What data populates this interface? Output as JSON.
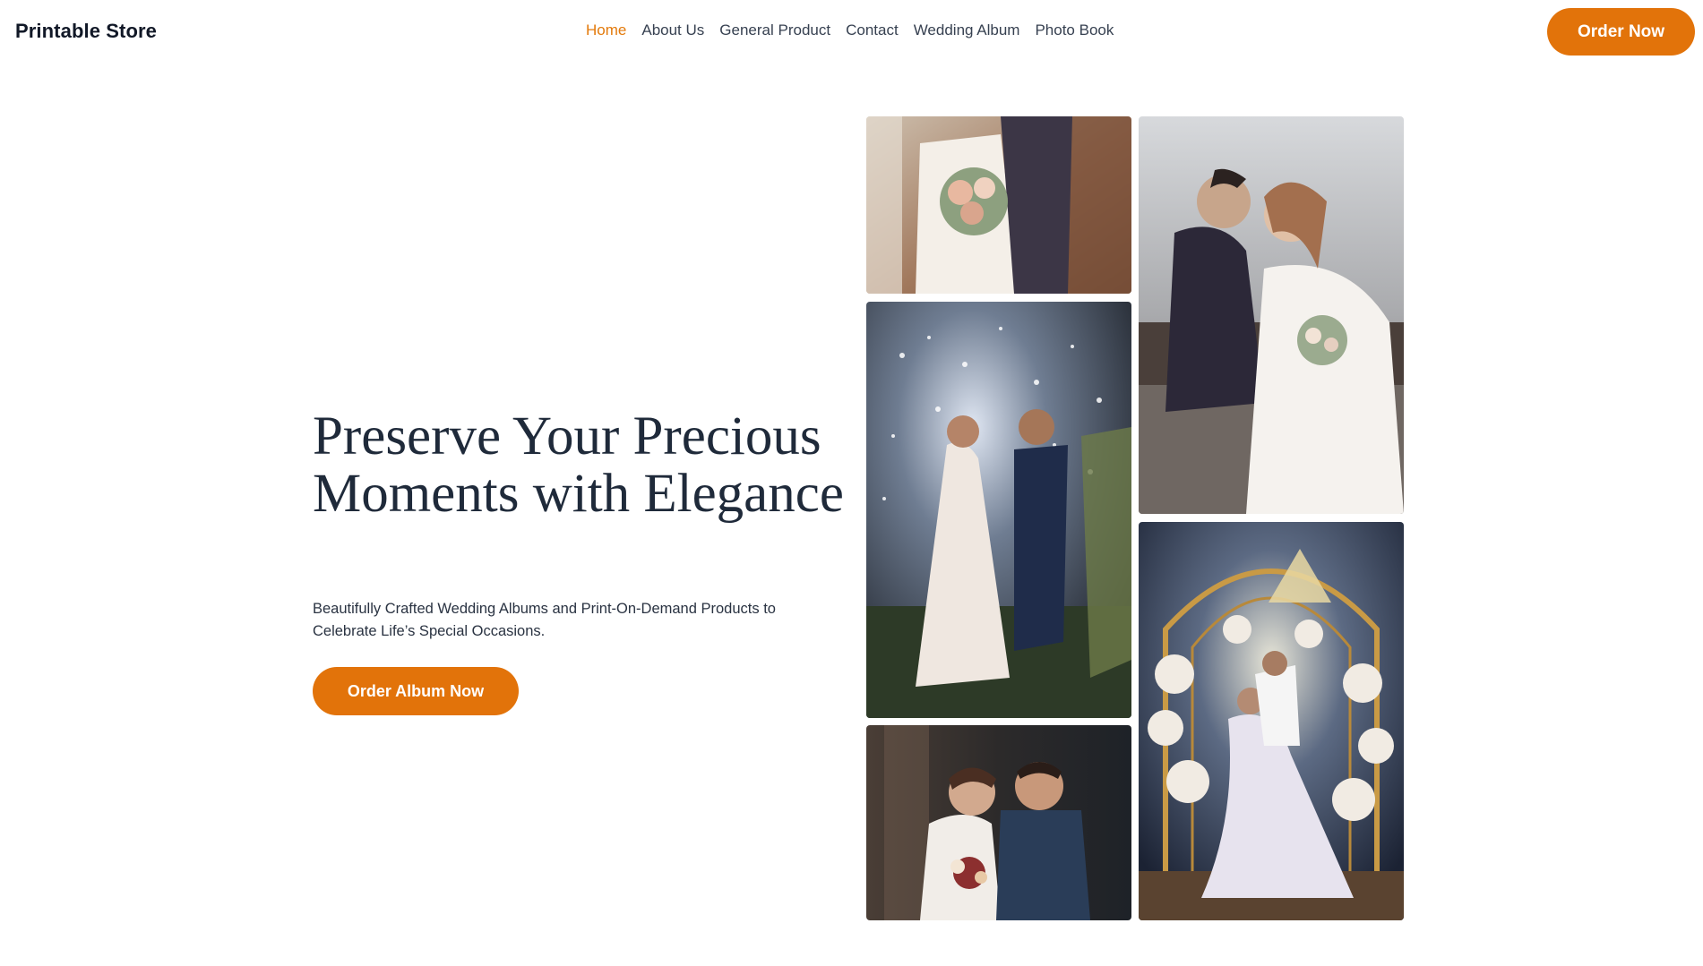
{
  "header": {
    "brand": "Printable Store",
    "nav": [
      {
        "label": "Home",
        "active": true
      },
      {
        "label": "About Us",
        "active": false
      },
      {
        "label": "General Product",
        "active": false
      },
      {
        "label": "Contact",
        "active": false
      },
      {
        "label": "Wedding Album",
        "active": false
      },
      {
        "label": "Photo Book",
        "active": false
      }
    ],
    "cta_label": "Order Now"
  },
  "hero": {
    "title": "Preserve Your Precious Moments with Elegance",
    "subtitle": "Beautifully Crafted Wedding Albums and Print-On-Demand Products to Celebrate Life’s Special Occasions.",
    "cta_label": "Order Album Now"
  },
  "colors": {
    "accent": "#e2730a",
    "active_nav": "#e37a0b",
    "heading": "#1f2a3a"
  }
}
